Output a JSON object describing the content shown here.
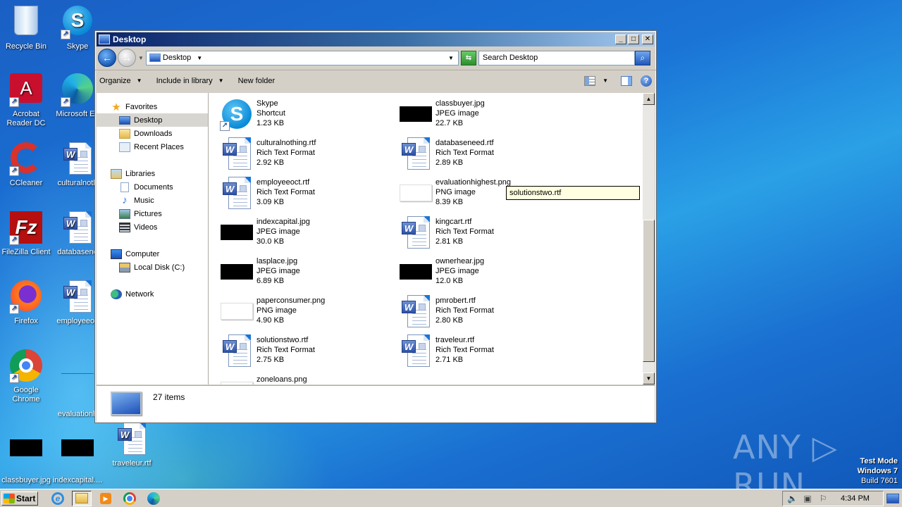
{
  "desktop": {
    "icons": [
      {
        "label": "Recycle Bin",
        "icon": "recycle-bin-icon"
      },
      {
        "label": "Skype",
        "icon": "skype-icon"
      },
      {
        "label": "Acrobat Reader DC",
        "icon": "acrobat-icon"
      },
      {
        "label": "Microsoft Ed",
        "icon": "edge-icon"
      },
      {
        "label": "CCleaner",
        "icon": "ccleaner-icon"
      },
      {
        "label": "culturalnoth",
        "icon": "word-doc-icon"
      },
      {
        "label": "FileZilla Client",
        "icon": "filezilla-icon"
      },
      {
        "label": "databasene",
        "icon": "word-doc-icon"
      },
      {
        "label": "Firefox",
        "icon": "firefox-icon"
      },
      {
        "label": "employeeoc",
        "icon": "word-doc-icon"
      },
      {
        "label": "Google Chrome",
        "icon": "chrome-icon"
      },
      {
        "label": "evaluationh",
        "icon": "image-icon"
      },
      {
        "label": "classbuyer.jpg",
        "icon": "image-icon"
      },
      {
        "label": "indexcapital....",
        "icon": "image-icon"
      },
      {
        "label": "traveleur.rtf",
        "icon": "word-doc-icon"
      }
    ],
    "watermark": "ANY ▷ RUN",
    "test_mode": {
      "line1": "Test Mode",
      "line2": "Windows 7",
      "line3": "Build 7601"
    }
  },
  "window": {
    "title": "Desktop",
    "controls": {
      "minimize": "_",
      "maximize": "□",
      "close": "✕"
    },
    "address": {
      "location": "Desktop"
    },
    "search": {
      "placeholder": "Search Desktop"
    },
    "toolbar": {
      "organize": "Organize",
      "include_in_library": "Include in library",
      "new_folder": "New folder"
    },
    "nav_pane": {
      "favorites": {
        "label": "Favorites",
        "items": [
          "Desktop",
          "Downloads",
          "Recent Places"
        ]
      },
      "libraries": {
        "label": "Libraries",
        "items": [
          "Documents",
          "Music",
          "Pictures",
          "Videos"
        ]
      },
      "computer": {
        "label": "Computer",
        "items": [
          "Local Disk (C:)"
        ]
      },
      "network": {
        "label": "Network"
      },
      "selected": "Desktop"
    },
    "files": [
      {
        "name": "Skype",
        "type": "Shortcut",
        "size": "1.23 KB",
        "thumb": "skype"
      },
      {
        "name": "classbuyer.jpg",
        "type": "JPEG image",
        "size": "22.7 KB",
        "thumb": "black"
      },
      {
        "name": "culturalnothing.rtf",
        "type": "Rich Text Format",
        "size": "2.92 KB",
        "thumb": "word"
      },
      {
        "name": "databaseneed.rtf",
        "type": "Rich Text Format",
        "size": "2.89 KB",
        "thumb": "word"
      },
      {
        "name": "employeeoct.rtf",
        "type": "Rich Text Format",
        "size": "3.09 KB",
        "thumb": "word"
      },
      {
        "name": "evaluationhighest.png",
        "type": "PNG image",
        "size": "8.39 KB",
        "thumb": "white"
      },
      {
        "name": "indexcapital.jpg",
        "type": "JPEG image",
        "size": "30.0 KB",
        "thumb": "black"
      },
      {
        "name": "kingcart.rtf",
        "type": "Rich Text Format",
        "size": "2.81 KB",
        "thumb": "word"
      },
      {
        "name": "lasplace.jpg",
        "type": "JPEG image",
        "size": "6.89 KB",
        "thumb": "black"
      },
      {
        "name": "ownerhear.jpg",
        "type": "JPEG image",
        "size": "12.0 KB",
        "thumb": "black"
      },
      {
        "name": "paperconsumer.png",
        "type": "PNG image",
        "size": "4.90 KB",
        "thumb": "white"
      },
      {
        "name": "pmrobert.rtf",
        "type": "Rich Text Format",
        "size": "2.80 KB",
        "thumb": "word"
      },
      {
        "name": "solutionstwo.rtf",
        "type": "Rich Text Format",
        "size": "2.75 KB",
        "thumb": "word"
      },
      {
        "name": "traveleur.rtf",
        "type": "Rich Text Format",
        "size": "2.71 KB",
        "thumb": "word"
      },
      {
        "name": "zoneloans.png",
        "type": "",
        "size": "",
        "thumb": "white"
      }
    ],
    "tooltip": "solutionstwo.rtf",
    "scroll": {
      "thumb_start_fraction": 0.43,
      "thumb_end_fraction": 0.96
    },
    "status": {
      "item_count": "27 items"
    }
  },
  "taskbar": {
    "start": "Start",
    "apps": [
      "internet-explorer",
      "windows-explorer",
      "media-player",
      "chrome",
      "edge"
    ],
    "active_app": "windows-explorer",
    "clock": "4:34 PM"
  }
}
